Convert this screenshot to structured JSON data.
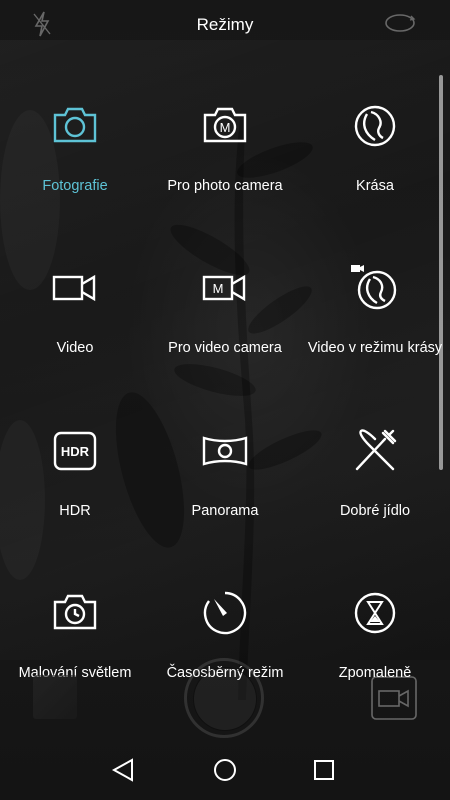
{
  "header": {
    "title": "Režimy"
  },
  "modes": [
    {
      "label": "Fotografie",
      "icon": "camera-icon",
      "active": true
    },
    {
      "label": "Pro photo camera",
      "icon": "pro-photo-icon",
      "active": false
    },
    {
      "label": "Krása",
      "icon": "beauty-icon",
      "active": false
    },
    {
      "label": "Video",
      "icon": "video-icon",
      "active": false
    },
    {
      "label": "Pro video camera",
      "icon": "pro-video-icon",
      "active": false
    },
    {
      "label": "Video v režimu krásy",
      "icon": "beauty-video-icon",
      "active": false
    },
    {
      "label": "HDR",
      "icon": "hdr-icon",
      "active": false
    },
    {
      "label": "Panorama",
      "icon": "panorama-icon",
      "active": false
    },
    {
      "label": "Dobré jídlo",
      "icon": "food-icon",
      "active": false
    },
    {
      "label": "Malování světlem",
      "icon": "light-painting-icon",
      "active": false
    },
    {
      "label": "Časosběrný režim",
      "icon": "timelapse-icon",
      "active": false
    },
    {
      "label": "Zpomaleně",
      "icon": "slow-motion-icon",
      "active": false
    }
  ],
  "icon_text": {
    "pro": "M",
    "hdr": "HDR"
  },
  "colors": {
    "accent": "#5ec3d6",
    "text": "#ffffff",
    "background": "#141414"
  }
}
